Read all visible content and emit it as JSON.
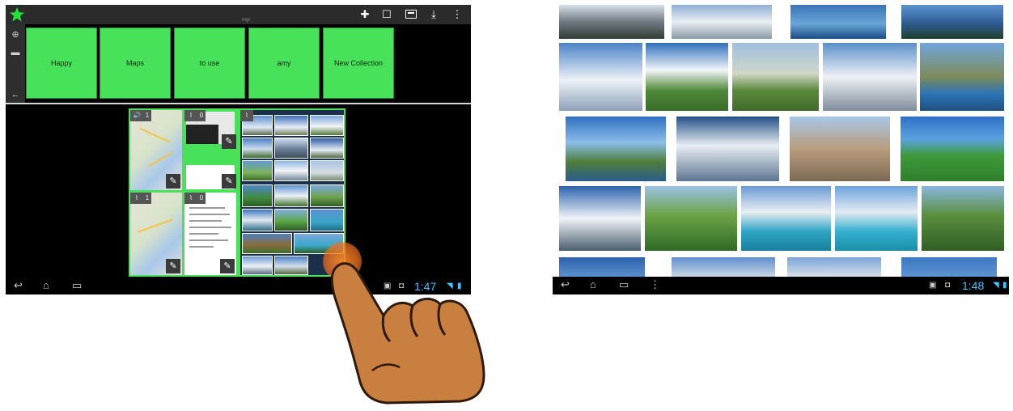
{
  "left_screen": {
    "toolbar_icons": [
      "star-icon",
      "add-icon",
      "square-icon",
      "card-icon",
      "download-icon",
      "more-vert-icon"
    ],
    "tiny_label": "mgr",
    "collections": [
      "Happy",
      "Maps",
      "to use",
      "amy",
      "New Collection"
    ],
    "badges": {
      "audio": "1",
      "clip": "0",
      "n3": "1",
      "n4": "0"
    },
    "time": "1:47"
  },
  "right_screen": {
    "time": "1:48"
  },
  "colors": {
    "tile_green": "#48e25a",
    "clock_blue": "#40c4ff",
    "touch_orange": "#f07a22"
  }
}
